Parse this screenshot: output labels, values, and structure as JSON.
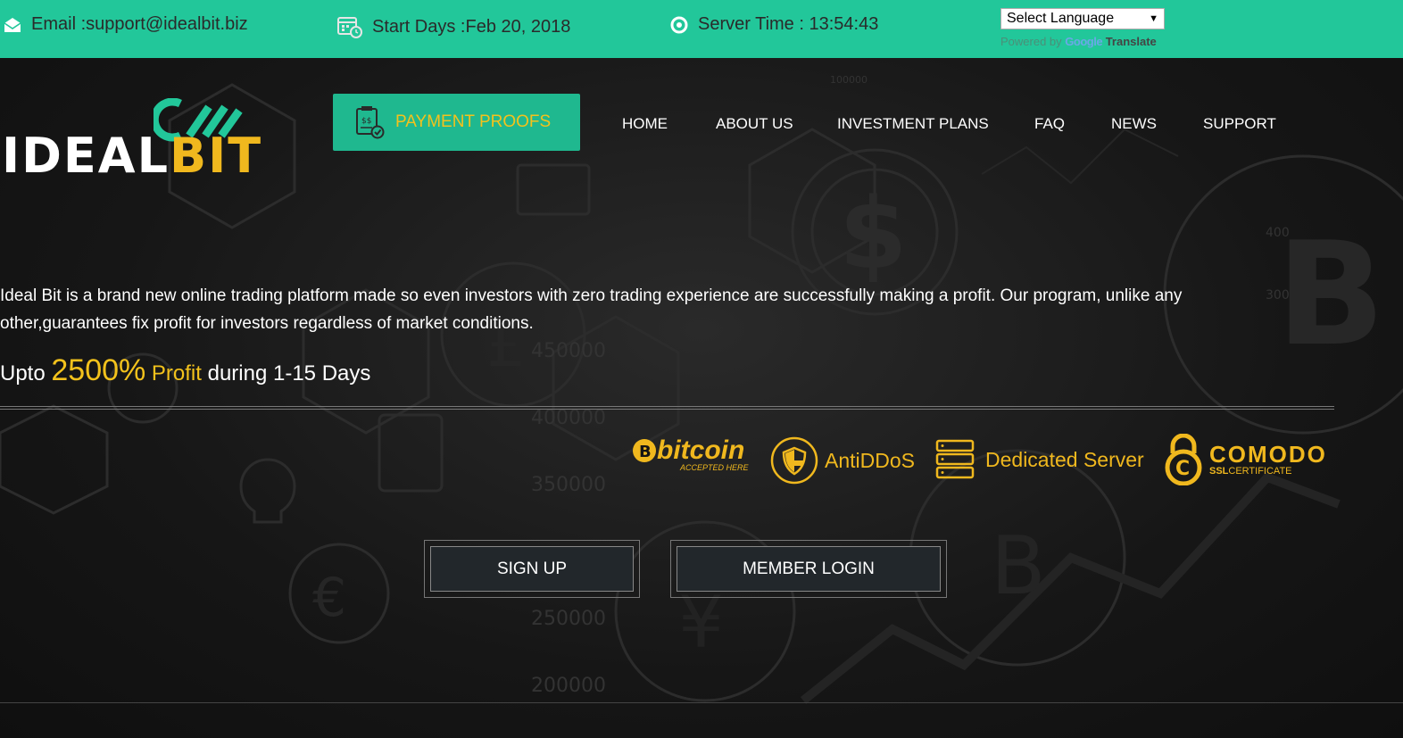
{
  "topbar": {
    "email": "Email :support@idealbit.biz",
    "start_days": "Start Days :Feb 20, 2018",
    "server_time": "Server Time : 13:54:43",
    "language_select": "Select Language",
    "powered_by": "Powered by",
    "google": "Google",
    "translate": "Translate"
  },
  "logo": {
    "ideal": "IDEAL",
    "bit": "BIT"
  },
  "payment_proofs": "PAYMENT PROOFS",
  "nav": [
    "HOME",
    "ABOUT US",
    "INVESTMENT PLANS",
    "FAQ",
    "NEWS",
    "SUPPORT"
  ],
  "intro": "Ideal Bit is a brand new online trading platform made so even investors with zero trading experience are successfully making a profit. Our program, unlike any other,guarantees fix profit for investors regardless of market conditions.",
  "tagline": {
    "prefix": "Upto ",
    "percent": "2500%",
    "profit": " Profit",
    "suffix": " during 1-15 Days"
  },
  "badges": {
    "bitcoin": "bitcoin",
    "bitcoin_sub": "ACCEPTED HERE",
    "antiddos": "AntiDDoS",
    "dedicated": "Dedicated Server",
    "comodo": "COMODO",
    "comodo_ssl": "SSL",
    "comodo_cert": "CERTIFICATE"
  },
  "buttons": {
    "signup": "SIGN UP",
    "login": "MEMBER LOGIN"
  },
  "background_chart_labels": [
    "100000",
    "450000",
    "400000",
    "350000",
    "250000",
    "200000",
    "400",
    "300"
  ],
  "colors": {
    "topbar": "#22c79a",
    "accent": "#f0b81e",
    "button_green": "#1fb88f"
  }
}
